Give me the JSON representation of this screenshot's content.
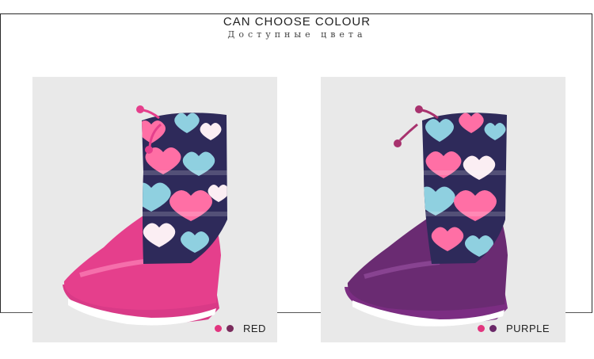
{
  "header": {
    "title": "CAN CHOOSE COLOUR",
    "subtitle": "Доступные цвета"
  },
  "variants": [
    {
      "label": "RED",
      "swatch_colors": [
        "#e2357f",
        "#7a2b5c"
      ],
      "boot_color": "#e53f8c",
      "sole_color": "#d93a87",
      "shaft_color": "#2e2a5a"
    },
    {
      "label": "PURPLE",
      "swatch_colors": [
        "#e2357f",
        "#6a2868"
      ],
      "boot_color": "#6a2b72",
      "sole_color": "#7b2d82",
      "shaft_color": "#2e2a5a"
    }
  ],
  "colors": {
    "border": "#2a2a2a",
    "card_bg": "#e9e9e9",
    "heart_pink": "#ff6fa5",
    "heart_blue": "#8fd0e0",
    "heart_white": "#fbeef3"
  }
}
